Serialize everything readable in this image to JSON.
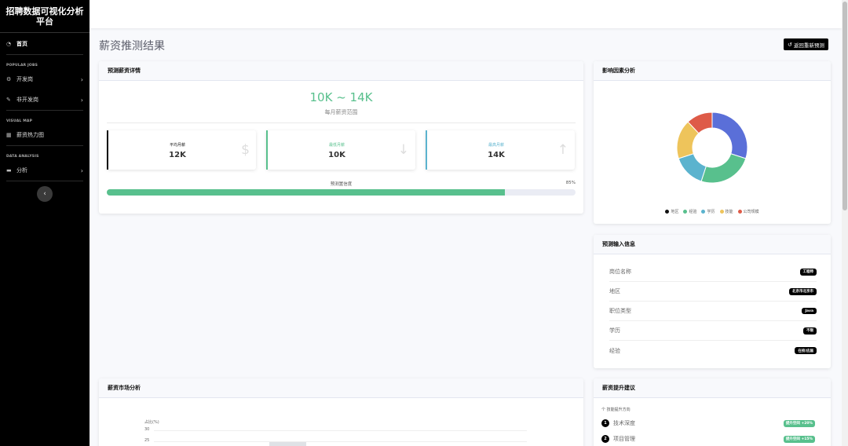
{
  "sidebar": {
    "brand": "招聘数据可视化分析平台",
    "home": {
      "label": "首页",
      "icon": "dashboard-icon"
    },
    "sections": {
      "popular": "POPULAR JOBS",
      "visual": "VISUAL MAP",
      "analysis": "DATA ANALYSIS"
    },
    "items": [
      {
        "label": "开发岗",
        "icon": "gear-icon"
      },
      {
        "label": "非开发岗",
        "icon": "wrench-icon"
      },
      {
        "label": "薪资热力图",
        "icon": "bar-chart-icon"
      },
      {
        "label": "分析",
        "icon": "folder-icon"
      }
    ]
  },
  "header": {
    "title": "薪资推测结果",
    "redo_label": "返回重新预测"
  },
  "detail": {
    "title": "预测薪资详情",
    "range": "10K ~ 14K",
    "range_caption": "每月薪资范围",
    "stats": [
      {
        "label": "平均月薪",
        "value": "12K",
        "accent": "#111111",
        "icon": "dollar-icon"
      },
      {
        "label": "最低月薪",
        "value": "10K",
        "accent": "#58c08d",
        "icon": "arrow-down-icon"
      },
      {
        "label": "最高月薪",
        "value": "14K",
        "accent": "#5bb3ce",
        "icon": "arrow-up-icon"
      }
    ],
    "confidence_label": "预测置信度",
    "confidence_pct": "85%",
    "confidence_value": 85
  },
  "factors": {
    "title": "影响因素分析",
    "legend": [
      {
        "label": "地区",
        "color": "#111111"
      },
      {
        "label": "经验",
        "color": "#58c08d"
      },
      {
        "label": "学历",
        "color": "#5bb3ce"
      },
      {
        "label": "技能",
        "color": "#eec45b"
      },
      {
        "label": "公司规模",
        "color": "#de5b48"
      }
    ]
  },
  "chart_data": {
    "type": "pie",
    "categories": [
      "地区",
      "经验",
      "学历",
      "技能",
      "公司规模"
    ],
    "values": [
      30,
      25,
      15,
      18,
      12
    ],
    "colors": [
      "#5a6fd8",
      "#58c08d",
      "#5bb3ce",
      "#eec45b",
      "#de5b48"
    ],
    "legend_position": "bottom"
  },
  "inputs": {
    "title": "预测输入信息",
    "rows": [
      {
        "label": "岗位名称",
        "value": "工程师"
      },
      {
        "label": "地区",
        "value": "北京市北京市"
      },
      {
        "label": "职位类型",
        "value": "Java"
      },
      {
        "label": "学历",
        "value": "不限"
      },
      {
        "label": "经验",
        "value": "在校/应届"
      }
    ]
  },
  "market": {
    "title": "薪资市场分析",
    "axis_title": "占比(%)",
    "ticks": [
      "30",
      "25"
    ]
  },
  "advice": {
    "title": "薪资提升建议",
    "subtitle": "个 技能提升方向",
    "items": [
      {
        "num": "1",
        "label": "技术深度",
        "badge": "提升空间 +20%"
      },
      {
        "num": "2",
        "label": "项目管理",
        "badge": "提升空间 +15%"
      }
    ]
  }
}
